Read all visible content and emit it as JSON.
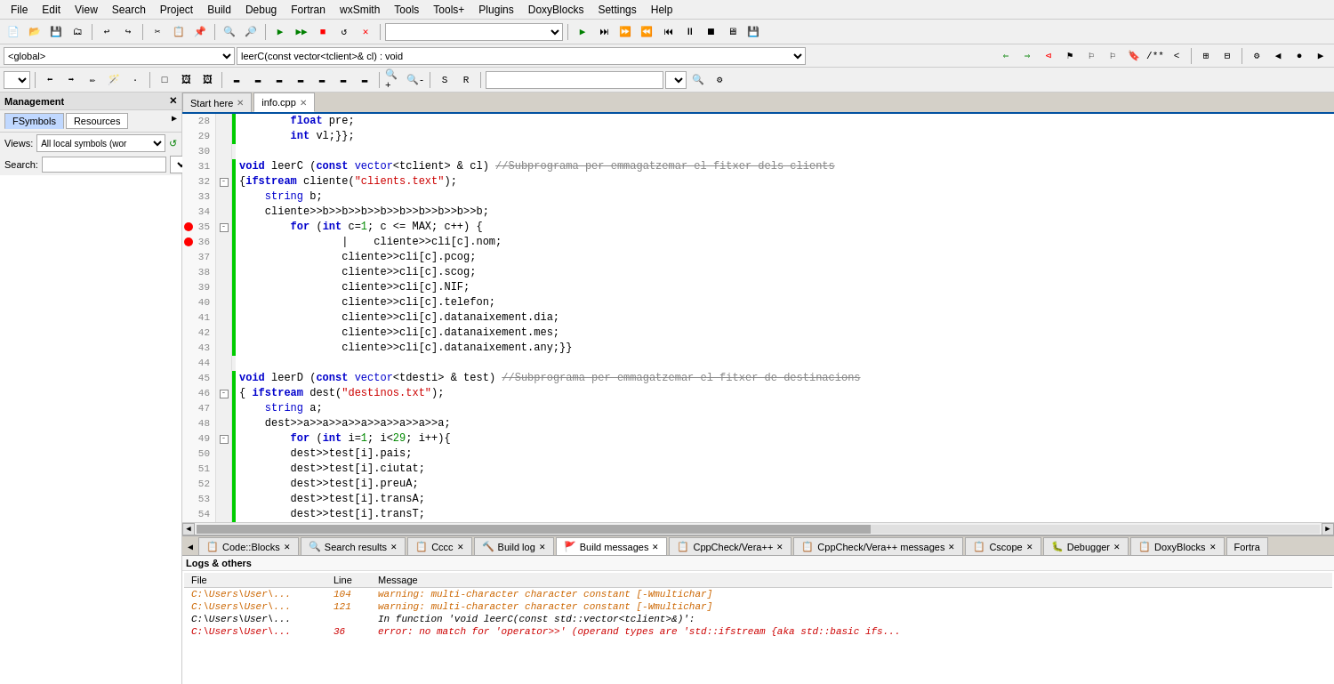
{
  "menubar": {
    "items": [
      "File",
      "Edit",
      "View",
      "Search",
      "Project",
      "Build",
      "Debug",
      "Fortran",
      "wxSmith",
      "Tools",
      "Tools+",
      "Plugins",
      "DoxyBlocks",
      "Settings",
      "Help"
    ]
  },
  "dropdowns": {
    "scope": "<global>",
    "function": "leerC(const vector<tclient>& cl) : void"
  },
  "tabs": {
    "editor": [
      {
        "label": "Start here",
        "active": false
      },
      {
        "label": "info.cpp",
        "active": true
      }
    ]
  },
  "sidebar": {
    "title": "Management",
    "tabs": [
      "FSymbols",
      "Resources"
    ],
    "view_label": "Views:",
    "view_value": "All local symbols (wor",
    "search_label": "Search:"
  },
  "code_lines": [
    {
      "num": 28,
      "indent": 2,
      "text": "    float pre;",
      "green": true,
      "collapse": false,
      "bp": false
    },
    {
      "num": 29,
      "indent": 2,
      "text": "    int vl;};",
      "green": true,
      "collapse": false,
      "bp": false
    },
    {
      "num": 30,
      "indent": 0,
      "text": "",
      "green": false,
      "collapse": false,
      "bp": false
    },
    {
      "num": 31,
      "indent": 0,
      "text": "void leerC (const vector<tclient> & cl) //Subprograma per emmagatzemar el fitxer dels clients",
      "green": true,
      "collapse": false,
      "bp": false,
      "has_strike": true
    },
    {
      "num": 32,
      "indent": 0,
      "text": "{ifstream cliente(\"clients.text\");",
      "green": true,
      "collapse": true,
      "bp": false
    },
    {
      "num": 33,
      "indent": 1,
      "text": "string b;",
      "green": true,
      "collapse": false,
      "bp": false
    },
    {
      "num": 34,
      "indent": 1,
      "text": "cliente>>b>>b>>b>>b>>b>>b>>b>>b>>b;",
      "green": true,
      "collapse": false,
      "bp": false
    },
    {
      "num": 35,
      "indent": 1,
      "text": "    for (int c=1; c <= MAX; c++) {",
      "green": true,
      "collapse": true,
      "bp": true
    },
    {
      "num": 36,
      "indent": 2,
      "text": "        cliente>>cli[c].nom;",
      "green": true,
      "collapse": false,
      "bp": true
    },
    {
      "num": 37,
      "indent": 2,
      "text": "        cliente>>cli[c].pcog;",
      "green": true,
      "collapse": false,
      "bp": false
    },
    {
      "num": 38,
      "indent": 2,
      "text": "        cliente>>cli[c].scog;",
      "green": true,
      "collapse": false,
      "bp": false
    },
    {
      "num": 39,
      "indent": 2,
      "text": "        cliente>>cli[c].NIF;",
      "green": true,
      "collapse": false,
      "bp": false
    },
    {
      "num": 40,
      "indent": 2,
      "text": "        cliente>>cli[c].telefon;",
      "green": true,
      "collapse": false,
      "bp": false
    },
    {
      "num": 41,
      "indent": 2,
      "text": "        cliente>>cli[c].datanaixement.dia;",
      "green": true,
      "collapse": false,
      "bp": false
    },
    {
      "num": 42,
      "indent": 2,
      "text": "        cliente>>cli[c].datanaixement.mes;",
      "green": true,
      "collapse": false,
      "bp": false
    },
    {
      "num": 43,
      "indent": 2,
      "text": "        cliente>>cli[c].datanaixement.any;}}",
      "green": true,
      "collapse": false,
      "bp": false
    },
    {
      "num": 44,
      "indent": 0,
      "text": "",
      "green": false,
      "collapse": false,
      "bp": false
    },
    {
      "num": 45,
      "indent": 0,
      "text": "void leerD (const vector<tdesti> & test) //Subprograma per emmagatzemar el fitxer de destinacions",
      "green": true,
      "collapse": false,
      "bp": false,
      "has_strike": true
    },
    {
      "num": 46,
      "indent": 0,
      "text": "{ ifstream dest(\"destinos.txt\");",
      "green": true,
      "collapse": true,
      "bp": false
    },
    {
      "num": 47,
      "indent": 1,
      "text": "string a;",
      "green": true,
      "collapse": false,
      "bp": false
    },
    {
      "num": 48,
      "indent": 1,
      "text": "dest>>a>>a>>a>>a>>a>>a>>a>>a;",
      "green": true,
      "collapse": false,
      "bp": false
    },
    {
      "num": 49,
      "indent": 1,
      "text": "    for (int i=1; i<29; i++){",
      "green": true,
      "collapse": true,
      "bp": false
    },
    {
      "num": 50,
      "indent": 2,
      "text": "    dest>>test[i].pais;",
      "green": true,
      "collapse": false,
      "bp": false
    },
    {
      "num": 51,
      "indent": 2,
      "text": "    dest>>test[i].ciutat;",
      "green": true,
      "collapse": false,
      "bp": false
    },
    {
      "num": 52,
      "indent": 2,
      "text": "    dest>>test[i].preuA;",
      "green": true,
      "collapse": false,
      "bp": false
    },
    {
      "num": 53,
      "indent": 2,
      "text": "    dest>>test[i].transA;",
      "green": true,
      "collapse": false,
      "bp": false
    },
    {
      "num": 54,
      "indent": 2,
      "text": "    dest>>test[i].transT;",
      "green": true,
      "collapse": false,
      "bp": false
    }
  ],
  "bottom_tabs": [
    {
      "label": "Code::Blocks",
      "active": false,
      "closable": true
    },
    {
      "label": "Search results",
      "active": false,
      "closable": true
    },
    {
      "label": "Cccc",
      "active": false,
      "closable": true
    },
    {
      "label": "Build log",
      "active": false,
      "closable": true
    },
    {
      "label": "Build messages",
      "active": true,
      "closable": true
    },
    {
      "label": "CppCheck/Vera++",
      "active": false,
      "closable": true
    },
    {
      "label": "CppCheck/Vera++ messages",
      "active": false,
      "closable": true
    },
    {
      "label": "Cscope",
      "active": false,
      "closable": true
    },
    {
      "label": "Debugger",
      "active": false,
      "closable": true
    },
    {
      "label": "DoxyBlocks",
      "active": false,
      "closable": true
    },
    {
      "label": "Fortra",
      "active": false,
      "closable": false
    }
  ],
  "log_headers": [
    "File",
    "Line",
    "Message"
  ],
  "log_rows": [
    {
      "file": "C:\\Users\\User\\...",
      "line": "104",
      "message": "warning: multi-character character constant [-Wmultichar]",
      "type": "warning"
    },
    {
      "file": "C:\\Users\\User\\...",
      "line": "121",
      "message": "warning: multi-character character constant [-Wmultichar]",
      "type": "warning"
    },
    {
      "file": "C:\\Users\\User\\...",
      "line": "",
      "message": "In function 'void leerC(const std::vector<tclient>&)':",
      "type": "info"
    },
    {
      "file": "C:\\Users\\User\\...",
      "line": "36",
      "message": "error: no match for 'operator>>' (operand types are 'std::ifstream {aka std::basic ifs...",
      "type": "error"
    }
  ]
}
